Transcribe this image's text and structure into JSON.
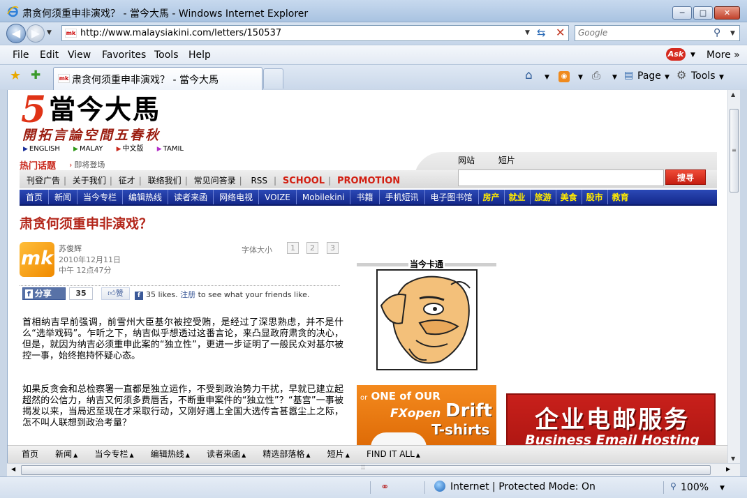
{
  "window": {
    "title": "肃贪何须重申非演戏？ - 當今大馬 - Windows Internet Explorer",
    "min_glyph": "─",
    "max_glyph": "□",
    "close_glyph": "✕"
  },
  "address_bar": {
    "url": "http://www.malaysiakini.com/letters/150537",
    "search_placeholder": "Google"
  },
  "menu": {
    "file": "File",
    "edit": "Edit",
    "view": "View",
    "favorites": "Favorites",
    "tools": "Tools",
    "help": "Help",
    "ask": "Ask",
    "more": "More"
  },
  "tab": {
    "title": "肃贪何须重申非演戏？ - 當今大馬",
    "favicon": "mk"
  },
  "command_bar": {
    "page": "Page",
    "tools": "Tools"
  },
  "site": {
    "logo_num": "5",
    "logo_text": "當今大馬",
    "slogan": "開拓言論空間五春秋",
    "languages": [
      "ENGLISH",
      "MALAY",
      "中文版",
      "TAMIL"
    ],
    "language_colors": [
      "#1a2f9a",
      "#2f9a1a",
      "#c8271b",
      "#b32fc8"
    ],
    "hot_label": "热门话题",
    "hot_sub": "即将登场",
    "search_tabs": [
      "网站",
      "短片"
    ],
    "search_button": "搜寻",
    "sublinks": [
      "刊登广告",
      "关于我们",
      "征才",
      "联络我们",
      "常见问答录",
      "RSS"
    ],
    "sublinks_red": [
      "SCHOOL",
      "PROMOTION"
    ],
    "nav": [
      "首页",
      "新闻",
      "当今专栏",
      "编辑热线",
      "读者来函",
      "网络电视",
      "VOIZE",
      "Mobilekini",
      "书籍",
      "手机短讯",
      "电子图书馆"
    ],
    "nav_highlight": [
      "房产",
      "就业",
      "旅游",
      "美食",
      "股市",
      "教育"
    ]
  },
  "article": {
    "headline": "肃贪何须重申非演戏？",
    "avatar": "mk",
    "author": "苏俊辉",
    "date": "2010年12月11日",
    "time": "中午  12点47分",
    "font_size_label": "字体大小",
    "font_sizes": [
      "1",
      "2",
      "3"
    ],
    "share_label": "分享",
    "share_count": "35",
    "like_button": "赞",
    "like_text": "35 likes.",
    "like_register": "注册",
    "like_suffix": "to see what your friends like.",
    "paragraphs": [
      "首相纳吉早前强调，前雪州大臣基尔被控受贿，是经过了深思熟虑，并不是什么“选举戏码”。乍听之下，纳吉似乎想透过这番言论，来凸显政府肃贪的决心，但是，就因为纳吉必须重申此案的“独立性”，更进一步证明了一般民众对基尔被控一事，始终抱持怀疑心态。",
      "如果反贪会和总检察署一直都是独立运作，不受到政治势力干扰，早就已建立起超然的公信力，纳吉又何须多费唇舌，不断重申案件的“独立性”？“基宫”一事被揭发以来，当局迟至现在才采取行动，又刚好遇上全国大选传言甚嚣尘上之际，怎不叫人联想到政治考量？"
    ]
  },
  "sidebar": {
    "cartoon_title": "当今卡通"
  },
  "ads": {
    "tshirt_or": "or",
    "tshirt_line1": "ONE of OUR",
    "tshirt_brand": "FXopen",
    "tshirt_drift": "Drift",
    "tshirt_tshirts": "T-shirts",
    "email_cn": "企业电邮服务",
    "email_en": "Business Email Hosting"
  },
  "bottom_bar": [
    "首页",
    "新闻",
    "当今专栏",
    "编辑热线",
    "读者来函",
    "精选部落格",
    "短片",
    "FIND IT ALL"
  ],
  "status": {
    "zone": "Internet | Protected Mode: On",
    "zoom": "100%"
  }
}
